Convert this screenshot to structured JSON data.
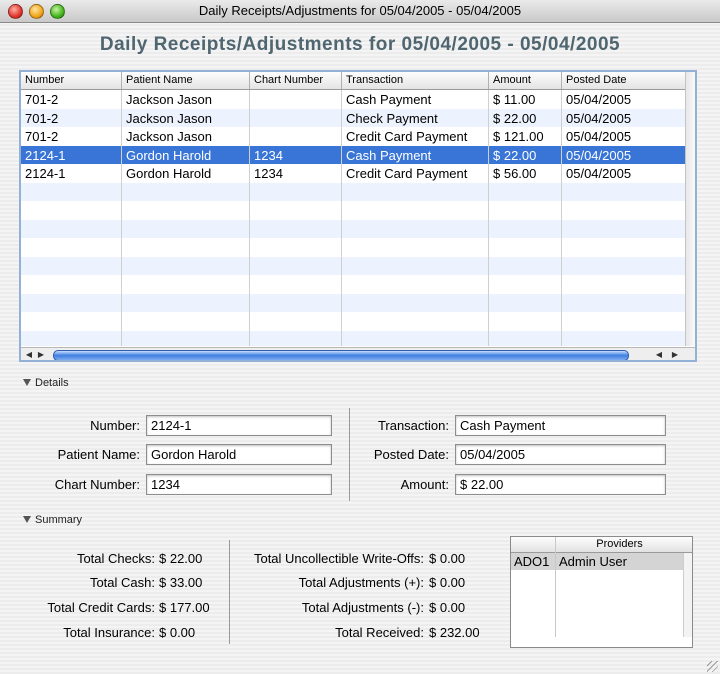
{
  "window": {
    "title": "Daily Receipts/Adjustments for 05/04/2005 - 05/04/2005"
  },
  "heading": "Daily Receipts/Adjustments for 05/04/2005 - 05/04/2005",
  "table": {
    "columns": [
      "Number",
      "Patient Name",
      "Chart Number",
      "Transaction",
      "Amount",
      "Posted Date"
    ],
    "rows": [
      [
        "701-2",
        "Jackson Jason",
        "",
        "Cash Payment",
        "$ 11.00",
        "05/04/2005"
      ],
      [
        "701-2",
        "Jackson Jason",
        "",
        "Check Payment",
        "$ 22.00",
        "05/04/2005"
      ],
      [
        "701-2",
        "Jackson Jason",
        "",
        "Credit Card Payment",
        "$ 121.00",
        "05/04/2005"
      ],
      [
        "2124-1",
        "Gordon Harold",
        "1234",
        "Cash Payment",
        "$ 22.00",
        "05/04/2005"
      ],
      [
        "2124-1",
        "Gordon Harold",
        "1234",
        "Credit Card Payment",
        "$ 56.00",
        "05/04/2005"
      ]
    ],
    "selected_row_index": 3,
    "selection_color": "#3875d7"
  },
  "details": {
    "label": "Details",
    "number_label": "Number:",
    "number": "2124-1",
    "patient_label": "Patient Name:",
    "patient": "Gordon Harold",
    "chart_label": "Chart Number:",
    "chart": "1234",
    "transaction_label": "Transaction:",
    "transaction": "Cash Payment",
    "posted_label": "Posted Date:",
    "posted": "05/04/2005",
    "amount_label": "Amount:",
    "amount": "$ 22.00"
  },
  "summary": {
    "label": "Summary",
    "left": [
      {
        "label": "Total Checks:",
        "value": "$ 22.00"
      },
      {
        "label": "Total Cash:",
        "value": "$ 33.00"
      },
      {
        "label": "Total Credit Cards:",
        "value": "$ 177.00"
      },
      {
        "label": "Total Insurance:",
        "value": "$ 0.00"
      }
    ],
    "right": [
      {
        "label": "Total Uncollectible Write-Offs:",
        "value": "$ 0.00"
      },
      {
        "label": "Total Adjustments (+):",
        "value": "$ 0.00"
      },
      {
        "label": "Total Adjustments (-):",
        "value": "$ 0.00"
      },
      {
        "label": "Total Received:",
        "value": "$ 232.00"
      }
    ],
    "providers": {
      "header": "Providers",
      "rows": [
        {
          "code": "ADO1",
          "name": "Admin User"
        }
      ]
    }
  }
}
